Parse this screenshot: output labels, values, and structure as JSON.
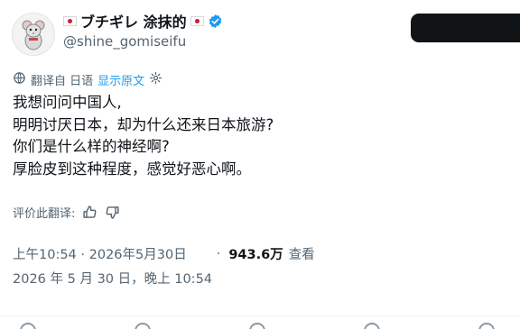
{
  "author": {
    "display_name": "ブチギレ 涂抹的",
    "handle": "@shine_gomiseifu",
    "verified": true,
    "avatar_icon": "rat-avatar-icon",
    "flag_icon": "japan-flag-icon"
  },
  "translation": {
    "label": "翻译自 日语",
    "show_original": "显示原文",
    "icon": "translate-icon",
    "settings_icon": "gear-icon"
  },
  "tweet": {
    "lines": [
      "我想问问中国人,",
      "明明讨厌日本，却为什么还来日本旅游?",
      "你们是什么样的神经啊?",
      "厚脸皮到这种程度，感觉好恶心啊。"
    ]
  },
  "rate_translation": {
    "label": "评价此翻译:",
    "thumbs_up_icon": "thumbs-up-icon",
    "thumbs_down_icon": "thumbs-down-icon"
  },
  "meta": {
    "time": "上午10:54 · 2026年5月30日",
    "separator": "·",
    "views_count": "943.6万",
    "views_label": "查看",
    "local_time": "2026 年 5 月 30 日，晚上 10:54"
  },
  "colors": {
    "text": "#0f1419",
    "muted": "#536471",
    "accent": "#1d9bf0",
    "flag_red": "#d7192c"
  }
}
